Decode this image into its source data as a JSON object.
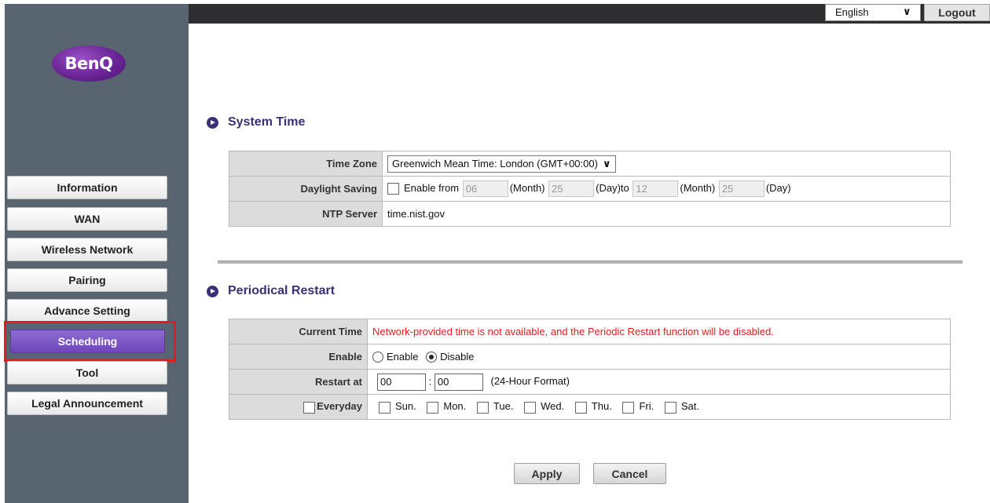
{
  "brand": {
    "logo_text": "BenQ",
    "accent": "#6d46b8",
    "heading_color": "#3b2f78",
    "alert_color": "#e01e1e"
  },
  "header": {
    "language": "English",
    "logout": "Logout"
  },
  "sidebar": {
    "items": [
      {
        "label": "Information"
      },
      {
        "label": "WAN"
      },
      {
        "label": "Wireless Network"
      },
      {
        "label": "Pairing"
      },
      {
        "label": "Advance Setting"
      },
      {
        "label": "Scheduling",
        "active": true
      },
      {
        "label": "Tool"
      },
      {
        "label": "Legal Announcement"
      }
    ]
  },
  "system_time": {
    "title": "System Time",
    "time_zone": {
      "label": "Time Zone",
      "value": "Greenwich Mean Time: London (GMT+00:00)"
    },
    "daylight": {
      "label": "Daylight Saving",
      "enable_text": "Enable from",
      "from_month": "06",
      "month_label": "(Month)",
      "from_day": "25",
      "day_to_label": "(Day)to",
      "to_month": "12",
      "to_day": "25",
      "day_label": "(Day)"
    },
    "ntp": {
      "label": "NTP Server",
      "value": "time.nist.gov"
    }
  },
  "periodical_restart": {
    "title": "Periodical Restart",
    "current_time": {
      "label": "Current Time",
      "value": "Network-provided time is not available, and the Periodic Restart function will be disabled."
    },
    "enable": {
      "label": "Enable",
      "opt_enable": "Enable",
      "opt_disable": "Disable",
      "selected": "Disable"
    },
    "restart_at": {
      "label": "Restart at",
      "hour": "00",
      "separator": ":",
      "minute": "00",
      "format": "(24-Hour Format)"
    },
    "everyday": {
      "label": "Everyday",
      "days": [
        "Sun.",
        "Mon.",
        "Tue.",
        "Wed.",
        "Thu.",
        "Fri.",
        "Sat."
      ]
    }
  },
  "buttons": {
    "apply": "Apply",
    "cancel": "Cancel"
  }
}
